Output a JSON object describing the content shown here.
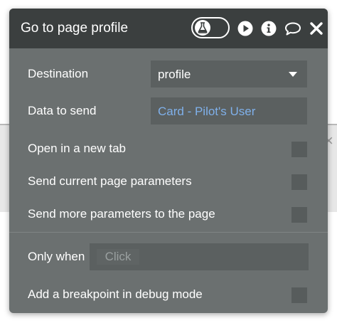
{
  "dialog": {
    "title": "Go to page profile",
    "header_icons": [
      "flask-icon",
      "play-icon",
      "info-icon",
      "comment-icon",
      "close-icon"
    ]
  },
  "fields": {
    "destination": {
      "label": "Destination",
      "value": "profile"
    },
    "data_to_send": {
      "label": "Data to send",
      "value": "Card - Pilot's User",
      "value_color": "#7fb0ea"
    }
  },
  "options": {
    "open_new_tab": {
      "label": "Open in a new tab",
      "checked": false
    },
    "send_current_params": {
      "label": "Send current page parameters",
      "checked": false
    },
    "send_more_params": {
      "label": "Send more parameters to the page",
      "checked": false
    }
  },
  "condition": {
    "label": "Only when",
    "placeholder": "Click"
  },
  "debug": {
    "label": "Add a breakpoint in debug mode",
    "checked": false
  },
  "colors": {
    "panel_bg": "#6b7070",
    "header_bg": "#3b3f3f",
    "field_bg": "#5b6060",
    "link_blue": "#7fb0ea"
  }
}
